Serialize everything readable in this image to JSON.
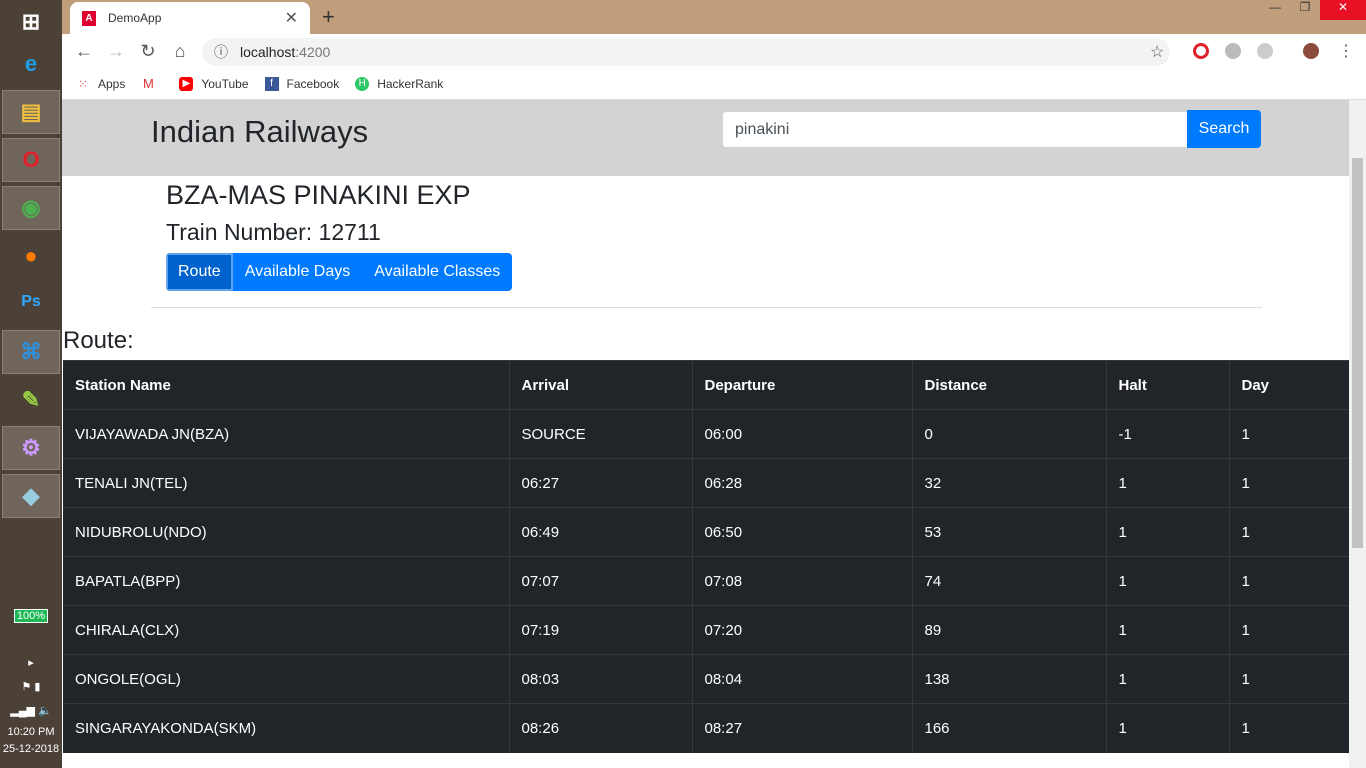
{
  "taskbar": {
    "battery": "100%",
    "time": "10:20 PM",
    "date": "25-12-2018"
  },
  "browser": {
    "tab_title": "DemoApp",
    "url_host": "localhost",
    "url_port": ":4200",
    "bookmarks": [
      "Apps",
      "YouTube",
      "Facebook",
      "HackerRank"
    ]
  },
  "header": {
    "brand": "Indian Railways",
    "search_value": "pinakini",
    "search_label": "Search"
  },
  "train": {
    "name": "BZA-MAS PINAKINI EXP",
    "number": "Train Number: 12711",
    "tabs": [
      "Route",
      "Available Days",
      "Available Classes"
    ],
    "active_tab": "Route"
  },
  "route": {
    "label": "Route:",
    "columns": [
      "Station Name",
      "Arrival",
      "Departure",
      "Distance",
      "Halt",
      "Day"
    ],
    "rows": [
      [
        "VIJAYAWADA JN(BZA)",
        "SOURCE",
        "06:00",
        "0",
        "-1",
        "1"
      ],
      [
        "TENALI JN(TEL)",
        "06:27",
        "06:28",
        "32",
        "1",
        "1"
      ],
      [
        "NIDUBROLU(NDO)",
        "06:49",
        "06:50",
        "53",
        "1",
        "1"
      ],
      [
        "BAPATLA(BPP)",
        "07:07",
        "07:08",
        "74",
        "1",
        "1"
      ],
      [
        "CHIRALA(CLX)",
        "07:19",
        "07:20",
        "89",
        "1",
        "1"
      ],
      [
        "ONGOLE(OGL)",
        "08:03",
        "08:04",
        "138",
        "1",
        "1"
      ],
      [
        "SINGARAYAKONDA(SKM)",
        "08:26",
        "08:27",
        "166",
        "1",
        "1"
      ]
    ]
  }
}
